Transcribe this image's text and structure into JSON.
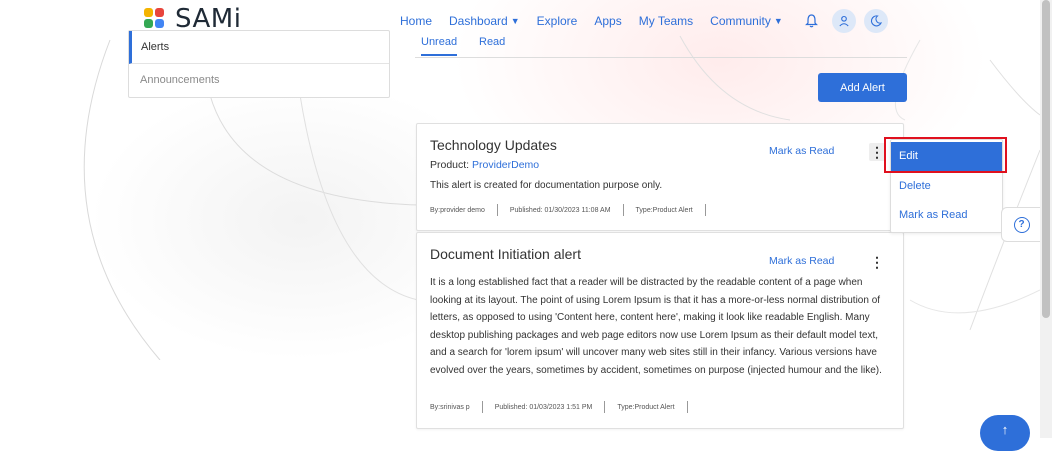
{
  "header": {
    "logo_text": "SAMi",
    "logo_colors": [
      "#f4b400",
      "#e8453c",
      "#34a853",
      "#4285f4"
    ],
    "nav": [
      {
        "label": "Home",
        "dropdown": false
      },
      {
        "label": "Dashboard",
        "dropdown": true
      },
      {
        "label": "Explore",
        "dropdown": false
      },
      {
        "label": "Apps",
        "dropdown": false
      },
      {
        "label": "My Teams",
        "dropdown": false
      },
      {
        "label": "Community",
        "dropdown": true
      }
    ],
    "icons": [
      "bell-icon",
      "user-icon",
      "moon-icon"
    ]
  },
  "sidebar": {
    "items": [
      {
        "label": "Alerts",
        "active": true
      },
      {
        "label": "Announcements",
        "active": false
      }
    ]
  },
  "tabs": {
    "unread": "Unread",
    "read": "Read",
    "selected": "Unread"
  },
  "add_alert_label": "Add Alert",
  "alerts": [
    {
      "title": "Technology Updates",
      "mark_read": "Mark as Read",
      "product_label": "Product:",
      "product_value": "ProviderDemo",
      "description": "This alert is created for documentation purpose only.",
      "by": "By:provider demo",
      "published": "Published: 01/30/2023 11:08 AM",
      "type": "Type:Product Alert"
    },
    {
      "title": "Document Initiation alert",
      "mark_read": "Mark as Read",
      "body": "It is a long established fact that a reader will be distracted by the readable content of a page when looking at its layout. The point of using Lorem Ipsum is that it has a more-or-less normal distribution of letters, as opposed to using 'Content here, content here', making it look like readable English. Many desktop publishing packages and web page editors now use Lorem Ipsum as their default model text, and a search for 'lorem ipsum' will uncover many web sites still in their infancy. Various versions have evolved over the years, sometimes by accident, sometimes on purpose (injected humour and the like).",
      "by": "By:srinivas p",
      "published": "Published: 01/03/2023 1:51 PM",
      "type": "Type:Product Alert"
    }
  ],
  "menu": {
    "items": [
      "Edit",
      "Delete",
      "Mark as Read"
    ],
    "selected": "Edit"
  },
  "help_icon": "question-circle-icon",
  "scroll_top_icon": "arrow-up-icon",
  "colors": {
    "primary": "#2e6fd9",
    "highlight": "#e0101e"
  }
}
